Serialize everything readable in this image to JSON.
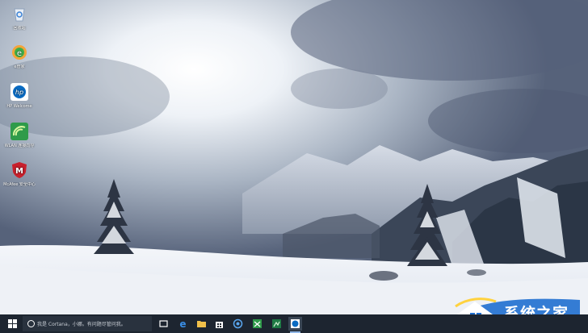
{
  "desktop": {
    "icons": [
      {
        "name": "recycle-bin",
        "label": "回收站"
      },
      {
        "name": "browser",
        "label": "e管家"
      },
      {
        "name": "hp-welcome",
        "label": "HP Welcome"
      },
      {
        "name": "wireless-app",
        "label": "WLAN 连接向导"
      },
      {
        "name": "mcafee",
        "label": "McAfee 安全中心"
      }
    ]
  },
  "taskbar": {
    "search_placeholder": "我是 Cortana，小娜。有问题尽管问我。",
    "pinned": [
      "task-view",
      "edge",
      "file-explorer",
      "store",
      "photos",
      "xbox",
      "spreadsheet",
      "hp-app"
    ],
    "active": "hp-app"
  },
  "watermark": {
    "text": "系统之家"
  },
  "colors": {
    "taskbar": "#1d2530",
    "accent": "#8fb6e6",
    "watermark_blue": "#1f6fd0"
  }
}
